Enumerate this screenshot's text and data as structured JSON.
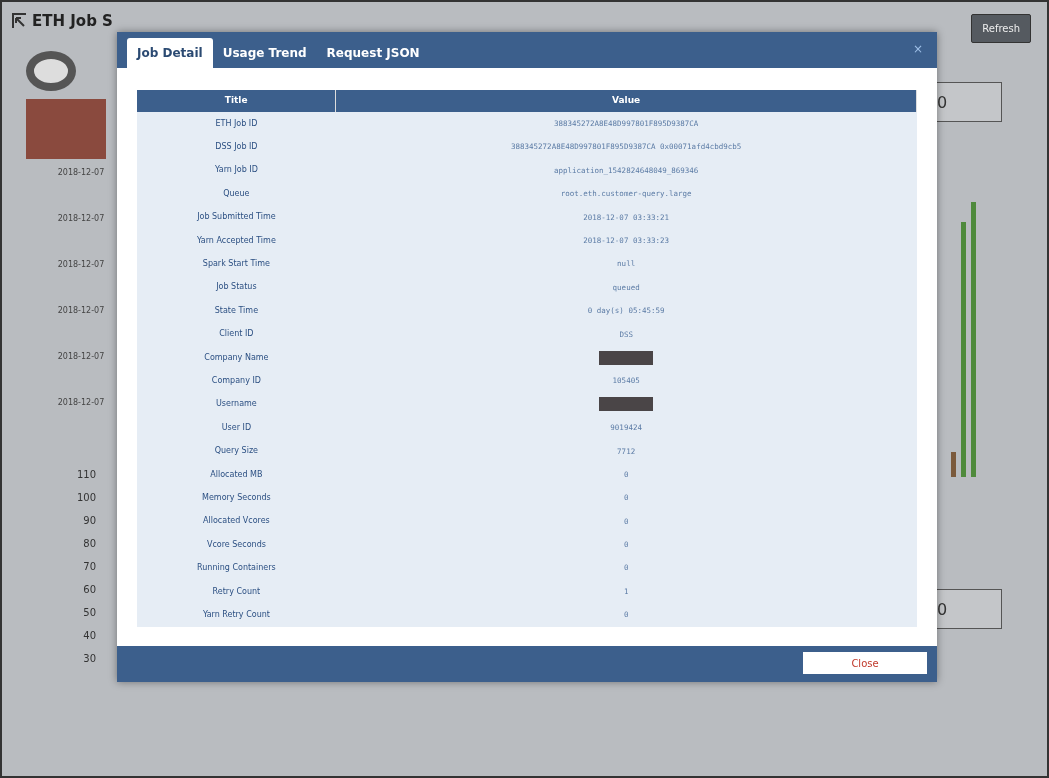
{
  "page": {
    "title": "ETH Job S",
    "refresh_button": "Refresh",
    "counters": [
      "0",
      "0"
    ],
    "table_dates": [
      "2018-12-07",
      "2018-12-07",
      "2018-12-07",
      "2018-12-07",
      "2018-12-07",
      "2018-12-07"
    ],
    "y_ticks": [
      "110",
      "100",
      "90",
      "80",
      "70",
      "60",
      "50",
      "40",
      "30"
    ]
  },
  "modal": {
    "tabs": [
      {
        "label": "Job Detail",
        "selected": true
      },
      {
        "label": "Usage Trend",
        "selected": false
      },
      {
        "label": "Request JSON",
        "selected": false
      }
    ],
    "close_icon": "×",
    "columns": [
      "Title",
      "Value"
    ],
    "rows": [
      {
        "title": "ETH Job ID",
        "kind": "text",
        "value": "388345272A8E48D997801F895D9387CA"
      },
      {
        "title": "DSS Job ID",
        "kind": "text",
        "value": "388345272A8E48D997801F895D9387CA 0x00071afd4cbd9cb5"
      },
      {
        "title": "Yarn Job ID",
        "kind": "text",
        "value": "application_1542824648049_869346"
      },
      {
        "title": "Queue",
        "kind": "text",
        "value": "root.eth.customer-query.large"
      },
      {
        "title": "Job Submitted Time",
        "kind": "text",
        "value": "2018-12-07 03:33:21"
      },
      {
        "title": "Yarn Accepted Time",
        "kind": "text",
        "value": "2018-12-07 03:33:23"
      },
      {
        "title": "Spark Start Time",
        "kind": "text",
        "value": "null"
      },
      {
        "title": "Job Status",
        "kind": "text",
        "value": "queued"
      },
      {
        "title": "State Time",
        "kind": "text",
        "value": "0 day(s) 05:45:59"
      },
      {
        "title": "Client ID",
        "kind": "text",
        "value": "DSS"
      },
      {
        "title": "Company Name",
        "kind": "redacted"
      },
      {
        "title": "Company ID",
        "kind": "text",
        "value": "105405"
      },
      {
        "title": "Username",
        "kind": "redacted"
      },
      {
        "title": "User ID",
        "kind": "text",
        "value": "9019424"
      },
      {
        "title": "Query Size",
        "kind": "text",
        "value": "7712"
      },
      {
        "title": "Allocated MB",
        "kind": "text",
        "value": "0"
      },
      {
        "title": "Memory Seconds",
        "kind": "text",
        "value": "0"
      },
      {
        "title": "Allocated Vcores",
        "kind": "text",
        "value": "0"
      },
      {
        "title": "Vcore Seconds",
        "kind": "text",
        "value": "0"
      },
      {
        "title": "Running Containers",
        "kind": "text",
        "value": "0"
      },
      {
        "title": "Retry Count",
        "kind": "text",
        "value": "1"
      },
      {
        "title": "Yarn Retry Count",
        "kind": "text",
        "value": "0"
      }
    ],
    "close_button": "Close"
  }
}
